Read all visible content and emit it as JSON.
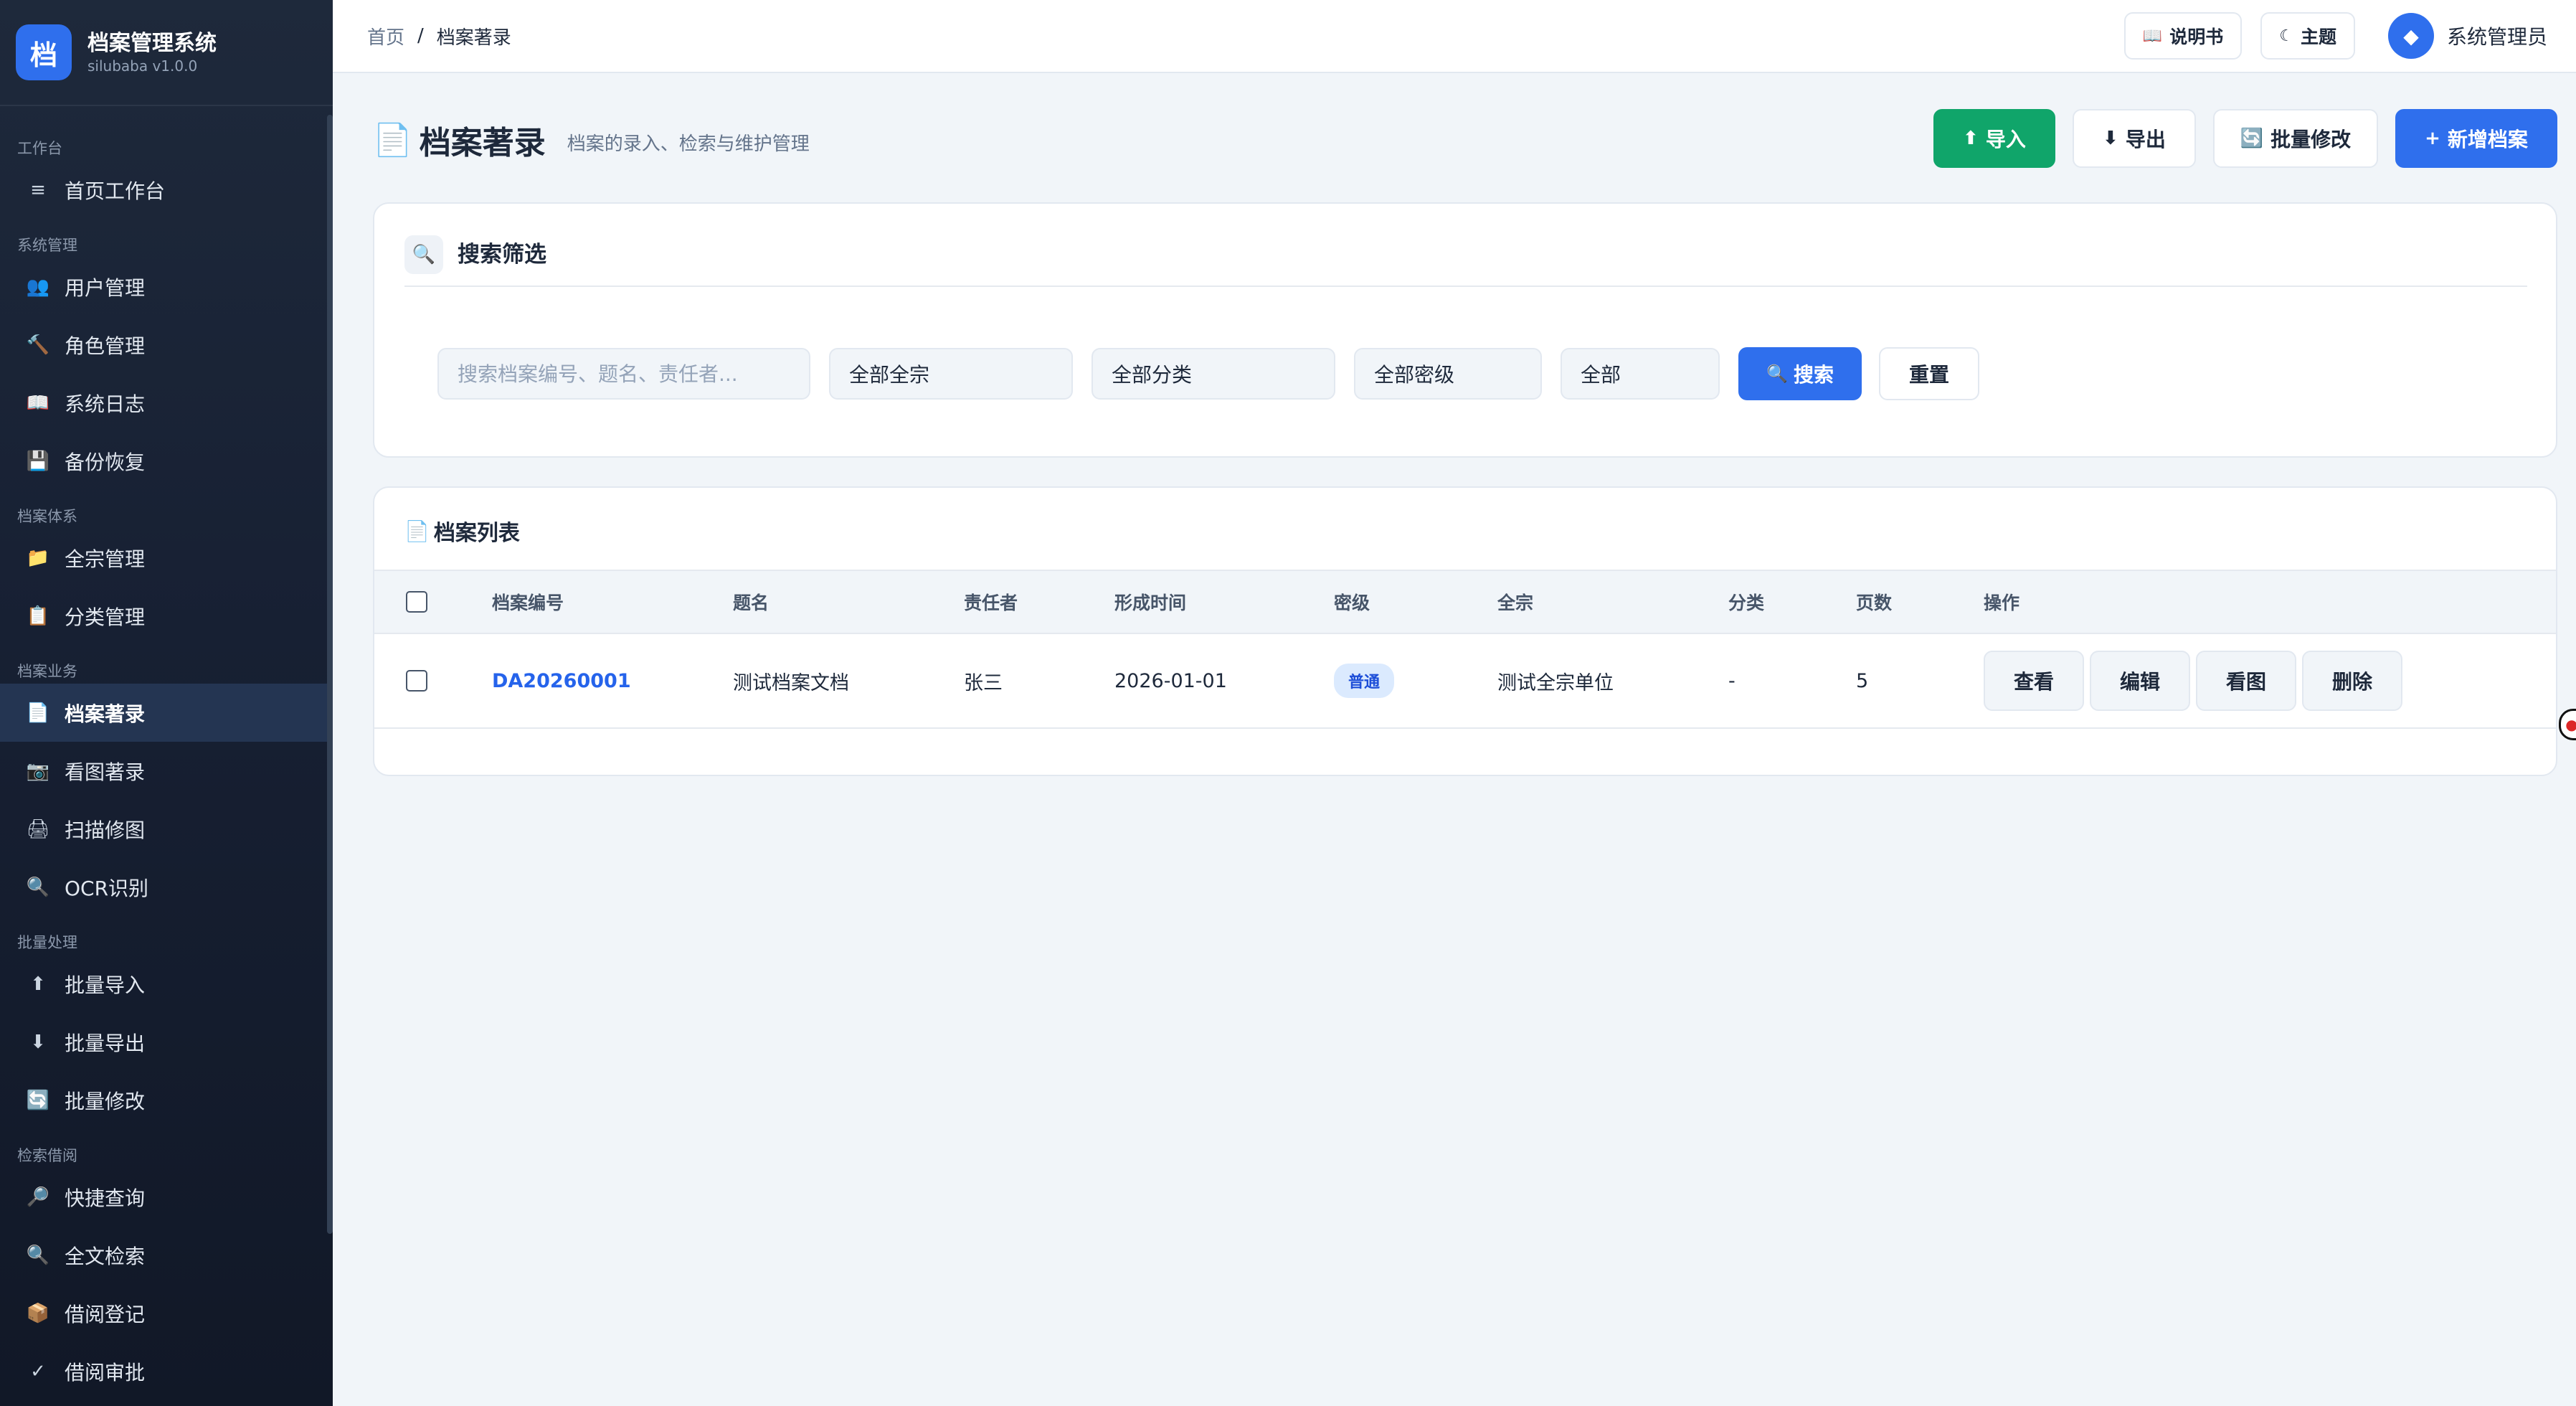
{
  "sidebar": {
    "logo_char": "档",
    "app_title": "档案管理系统",
    "app_version": "silubaba v1.0.0",
    "sections": [
      {
        "title": "工作台",
        "items": [
          {
            "label": "首页工作台",
            "icon": "≡",
            "icon_name": "menu-icon"
          }
        ]
      },
      {
        "title": "系统管理",
        "items": [
          {
            "label": "用户管理",
            "icon": "👥",
            "icon_name": "users-icon"
          },
          {
            "label": "角色管理",
            "icon": "🔨",
            "icon_name": "hammer-icon"
          },
          {
            "label": "系统日志",
            "icon": "📖",
            "icon_name": "book-icon"
          },
          {
            "label": "备份恢复",
            "icon": "💾",
            "icon_name": "floppy-icon"
          }
        ]
      },
      {
        "title": "档案体系",
        "items": [
          {
            "label": "全宗管理",
            "icon": "📁",
            "icon_name": "folder-icon"
          },
          {
            "label": "分类管理",
            "icon": "📋",
            "icon_name": "clipboard-icon"
          }
        ]
      },
      {
        "title": "档案业务",
        "items": [
          {
            "label": "档案著录",
            "icon": "📄",
            "icon_name": "document-icon",
            "active": true
          },
          {
            "label": "看图著录",
            "icon": "📷",
            "icon_name": "camera-icon"
          },
          {
            "label": "扫描修图",
            "icon": "🖨",
            "icon_name": "printer-icon"
          },
          {
            "label": "OCR识别",
            "icon": "🔍",
            "icon_name": "magnifier-icon"
          }
        ]
      },
      {
        "title": "批量处理",
        "items": [
          {
            "label": "批量导入",
            "icon": "⬆",
            "icon_name": "arrow-up-icon"
          },
          {
            "label": "批量导出",
            "icon": "⬇",
            "icon_name": "arrow-down-icon"
          },
          {
            "label": "批量修改",
            "icon": "🔄",
            "icon_name": "refresh-icon"
          }
        ]
      },
      {
        "title": "检索借阅",
        "items": [
          {
            "label": "快捷查询",
            "icon": "🔎",
            "icon_name": "search-icon"
          },
          {
            "label": "全文检索",
            "icon": "🔍",
            "icon_name": "magnifier-icon"
          },
          {
            "label": "借阅登记",
            "icon": "📦",
            "icon_name": "package-icon"
          },
          {
            "label": "借阅审批",
            "icon": "✓",
            "icon_name": "check-icon"
          }
        ]
      }
    ]
  },
  "topbar": {
    "breadcrumb": {
      "home": "首页",
      "separator": "/",
      "current": "档案著录"
    },
    "manual_icon": "📖",
    "manual_label": "说明书",
    "theme_icon": "☾",
    "theme_label": "主题",
    "avatar_icon": "◆",
    "user_name": "系统管理员"
  },
  "page": {
    "icon": "📄",
    "title": "档案著录",
    "subtitle": "档案的录入、检索与维护管理",
    "actions": {
      "import_icon": "⬆",
      "import_label": "导入",
      "export_icon": "⬇",
      "export_label": "导出",
      "batch_icon": "🔄",
      "batch_label": "批量修改",
      "new_icon": "+",
      "new_label": "新增档案"
    }
  },
  "search": {
    "icon": "🔍",
    "title": "搜索筛选",
    "placeholder": "搜索档案编号、题名、责任者...",
    "fonds_value": "全部全宗",
    "category_value": "全部分类",
    "security_value": "全部密级",
    "status_value": "全部",
    "search_icon": "🔍",
    "search_label": "搜索",
    "reset_label": "重置"
  },
  "list": {
    "icon": "📄",
    "title": "档案列表",
    "columns": [
      "档案编号",
      "题名",
      "责任者",
      "形成时间",
      "密级",
      "全宗",
      "分类",
      "页数",
      "操作"
    ],
    "rows": [
      {
        "archive_no": "DA20260001",
        "title": "测试档案文档",
        "author": "张三",
        "date": "2026-01-01",
        "security": "普通",
        "fonds": "测试全宗单位",
        "category": "-",
        "pages": "5",
        "actions": [
          "查看",
          "编辑",
          "看图",
          "删除"
        ]
      }
    ]
  },
  "colors": {
    "sidebar_bg": "#1e293b",
    "primary": "#2f6fed",
    "success": "#10a56a",
    "link": "#2563eb",
    "badge_bg": "#dbeafe"
  }
}
